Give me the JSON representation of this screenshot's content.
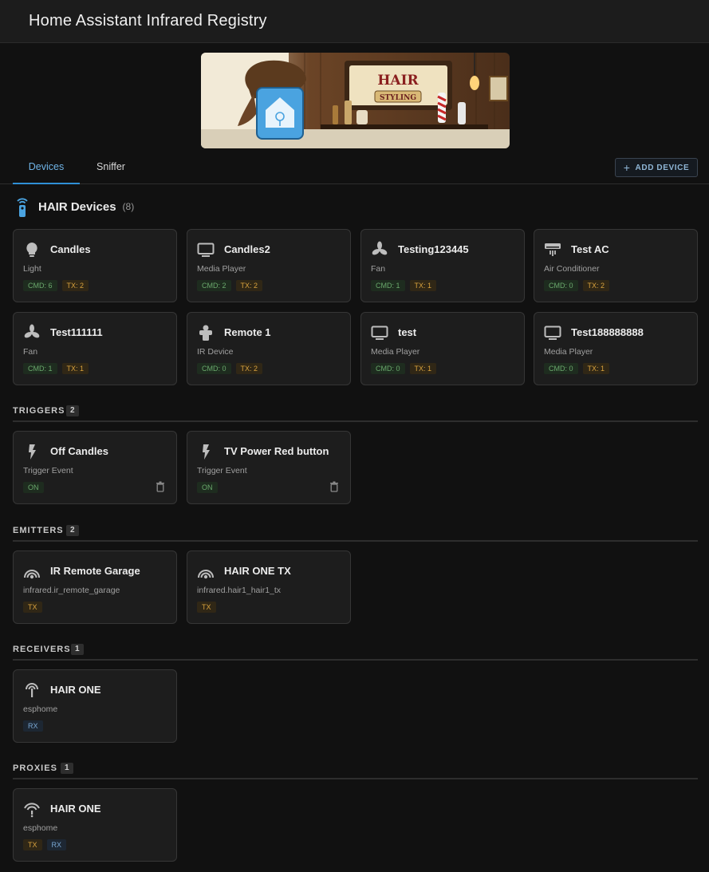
{
  "app": {
    "title": "Home Assistant Infrared Registry"
  },
  "banner": {
    "sign_line1": "HAIR",
    "sign_line2": "STYLING"
  },
  "tabs": [
    {
      "label": "Devices",
      "active": true
    },
    {
      "label": "Sniffer",
      "active": false
    }
  ],
  "add_device_label": "ADD DEVICE",
  "devices_section": {
    "title": "HAIR Devices",
    "count": "(8)"
  },
  "devices": [
    {
      "name": "Candles",
      "type": "Light",
      "icon": "lightbulb-icon",
      "cmd": "CMD: 6",
      "tx": "TX: 2"
    },
    {
      "name": "Candles2",
      "type": "Media Player",
      "icon": "tv-icon",
      "cmd": "CMD: 2",
      "tx": "TX: 2"
    },
    {
      "name": "Testing123445",
      "type": "Fan",
      "icon": "fan-icon",
      "cmd": "CMD: 1",
      "tx": "TX: 1"
    },
    {
      "name": "Test AC",
      "type": "Air Conditioner",
      "icon": "air-conditioner-icon",
      "cmd": "CMD: 0",
      "tx": "TX: 2"
    },
    {
      "name": "Test111111",
      "type": "Fan",
      "icon": "fan-icon",
      "cmd": "CMD: 1",
      "tx": "TX: 1"
    },
    {
      "name": "Remote 1",
      "type": "IR Device",
      "icon": "remote-icon",
      "cmd": "CMD: 0",
      "tx": "TX: 2"
    },
    {
      "name": "test",
      "type": "Media Player",
      "icon": "tv-icon",
      "cmd": "CMD: 0",
      "tx": "TX: 1"
    },
    {
      "name": "Test188888888",
      "type": "Media Player",
      "icon": "tv-icon",
      "cmd": "CMD: 0",
      "tx": "TX: 1"
    }
  ],
  "triggers_section": {
    "title": "TRIGGERS",
    "count": "2"
  },
  "triggers": [
    {
      "name": "Off Candles",
      "type": "Trigger Event",
      "icon": "lightning-icon",
      "state": "ON"
    },
    {
      "name": "TV Power Red button",
      "type": "Trigger Event",
      "icon": "lightning-icon",
      "state": "ON"
    }
  ],
  "emitters_section": {
    "title": "EMITTERS",
    "count": "2"
  },
  "emitters": [
    {
      "name": "IR Remote Garage",
      "entity": "infrared.ir_remote_garage",
      "icon": "emitter-icon",
      "badge": "TX"
    },
    {
      "name": "HAIR ONE TX",
      "entity": "infrared.hair1_hair1_tx",
      "icon": "emitter-icon",
      "badge": "TX"
    }
  ],
  "receivers_section": {
    "title": "RECEIVERS",
    "count": "1"
  },
  "receivers": [
    {
      "name": "HAIR ONE",
      "platform": "esphome",
      "icon": "receiver-icon",
      "badge": "RX"
    }
  ],
  "proxies_section": {
    "title": "PROXIES",
    "count": "1"
  },
  "proxies": [
    {
      "name": "HAIR ONE",
      "platform": "esphome",
      "icon": "proxy-icon",
      "badges": [
        "TX",
        "RX"
      ]
    }
  ]
}
